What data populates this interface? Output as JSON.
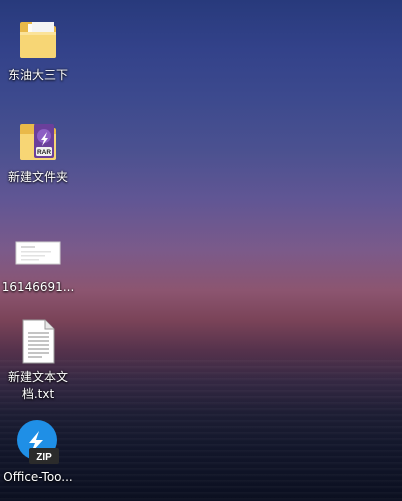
{
  "desktop": {
    "icons": [
      {
        "label": "东油大三下",
        "icon": "folder-icon"
      },
      {
        "label": "新建文件夹",
        "icon": "winrar-folder-icon",
        "badge": "RAR"
      },
      {
        "label": "16146691...",
        "icon": "image-file-icon"
      },
      {
        "label": "新建文本文\n档.txt",
        "icon": "text-file-icon"
      },
      {
        "label": "Office-Too...",
        "icon": "zip-shortcut-icon",
        "badge": "ZIP"
      }
    ]
  }
}
